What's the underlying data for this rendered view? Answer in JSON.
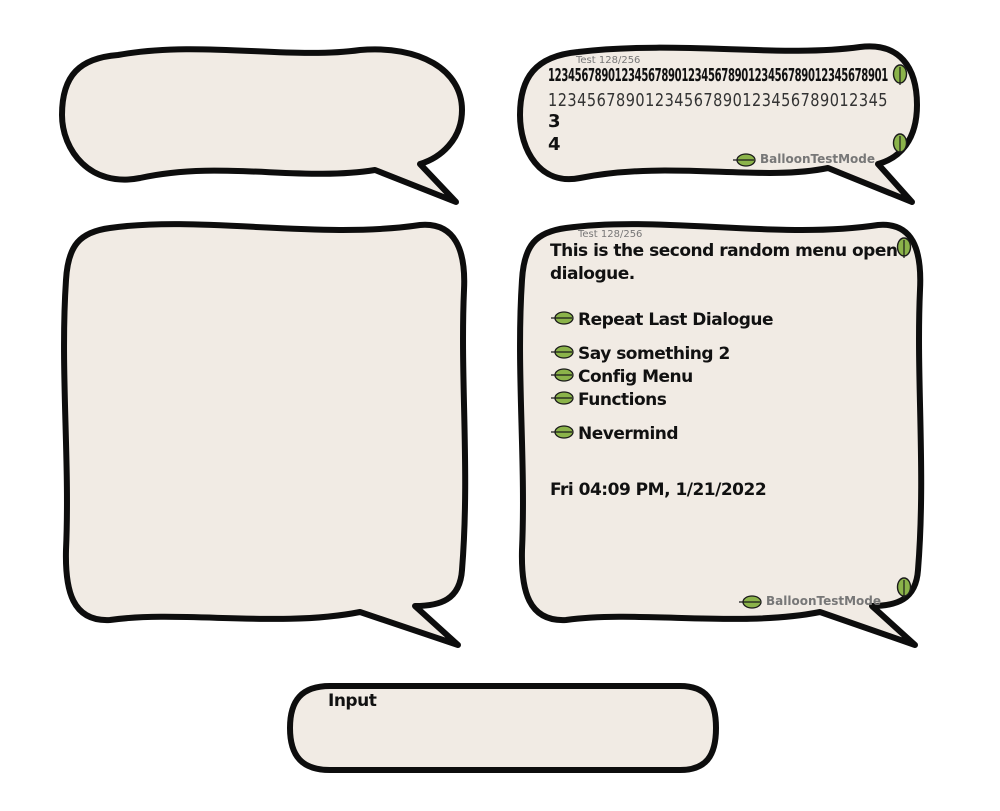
{
  "balloon_top_right": {
    "caption": "Test 128/256",
    "line1": "123456789012345678901234567890123456789012345678901",
    "line2": "12345678901234567890123456789012345",
    "line3": "3",
    "line4": "4",
    "mode_label": "BalloonTestMode"
  },
  "balloon_main": {
    "caption": "Test 128/256",
    "dialogue_line1": "This is the second random menu open",
    "dialogue_line2": "dialogue.",
    "menu": [
      {
        "label": "Repeat Last Dialogue"
      },
      {
        "label": "Say something 2"
      },
      {
        "label": "Config Menu"
      },
      {
        "label": "Functions"
      },
      {
        "label": "Nevermind"
      }
    ],
    "timestamp": "Fri 04:09 PM, 1/21/2022",
    "mode_label": "BalloonTestMode"
  },
  "input_box": {
    "label": "Input"
  },
  "colors": {
    "balloon_fill": "#f1ebe4",
    "outline": "#0d0d0d",
    "leaf_green": "#8bb34a",
    "caption_gray": "#777777"
  },
  "icons": [
    "leaf-icon"
  ]
}
